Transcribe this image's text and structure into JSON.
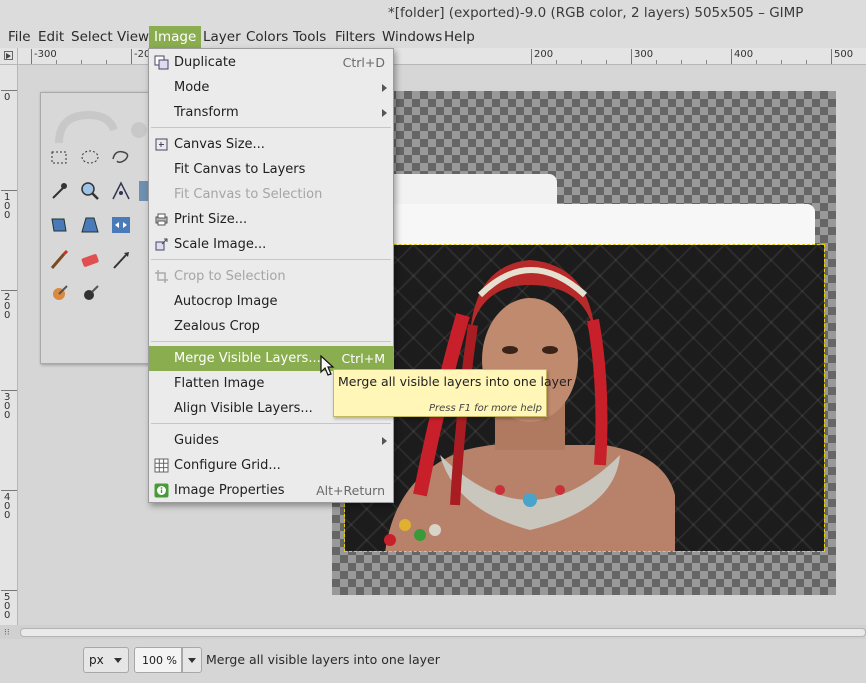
{
  "window": {
    "title": "*[folder] (exported)-9.0 (RGB color, 2 layers) 505x505 – GIMP"
  },
  "menubar": {
    "items": [
      "File",
      "Edit",
      "Select",
      "View",
      "Image",
      "Layer",
      "Colors",
      "Tools",
      "Filters",
      "Windows",
      "Help"
    ],
    "active": "Image"
  },
  "rulers": {
    "horizontal": [
      "-300",
      "-20",
      "200",
      "300",
      "400",
      "500"
    ],
    "vertical": [
      "0",
      "100",
      "200",
      "300",
      "400",
      "500"
    ]
  },
  "image_menu": {
    "items": [
      {
        "label": "Duplicate",
        "accel": "Ctrl+D",
        "icon": "duplicate-icon"
      },
      {
        "label": "Mode",
        "submenu": true
      },
      {
        "label": "Transform",
        "submenu": true
      },
      {
        "label": "Canvas Size...",
        "icon": "canvas-size-icon"
      },
      {
        "label": "Fit Canvas to Layers"
      },
      {
        "label": "Fit Canvas to Selection",
        "disabled": true
      },
      {
        "label": "Print Size...",
        "icon": "printer-icon"
      },
      {
        "label": "Scale Image...",
        "icon": "scale-icon"
      },
      {
        "label": "Crop to Selection",
        "disabled": true,
        "icon": "crop-icon"
      },
      {
        "label": "Autocrop Image"
      },
      {
        "label": "Zealous Crop"
      },
      {
        "label": "Merge Visible Layers...",
        "accel": "Ctrl+M",
        "highlighted": true
      },
      {
        "label": "Flatten Image"
      },
      {
        "label": "Align Visible Layers..."
      },
      {
        "label": "Guides",
        "submenu": true
      },
      {
        "label": "Configure Grid...",
        "icon": "grid-icon"
      },
      {
        "label": "Image Properties",
        "accel": "Alt+Return",
        "icon": "info-icon"
      }
    ]
  },
  "tooltip": {
    "text": "Merge all visible layers into one layer",
    "help": "Press F1 for more help"
  },
  "statusbar": {
    "unit": "px",
    "zoom": "100 %",
    "message": "Merge all visible layers into one layer"
  },
  "colors": {
    "highlight": "#8aad4f",
    "tooltip_bg": "#fff6b8",
    "selection_outline": "#e8d000"
  }
}
